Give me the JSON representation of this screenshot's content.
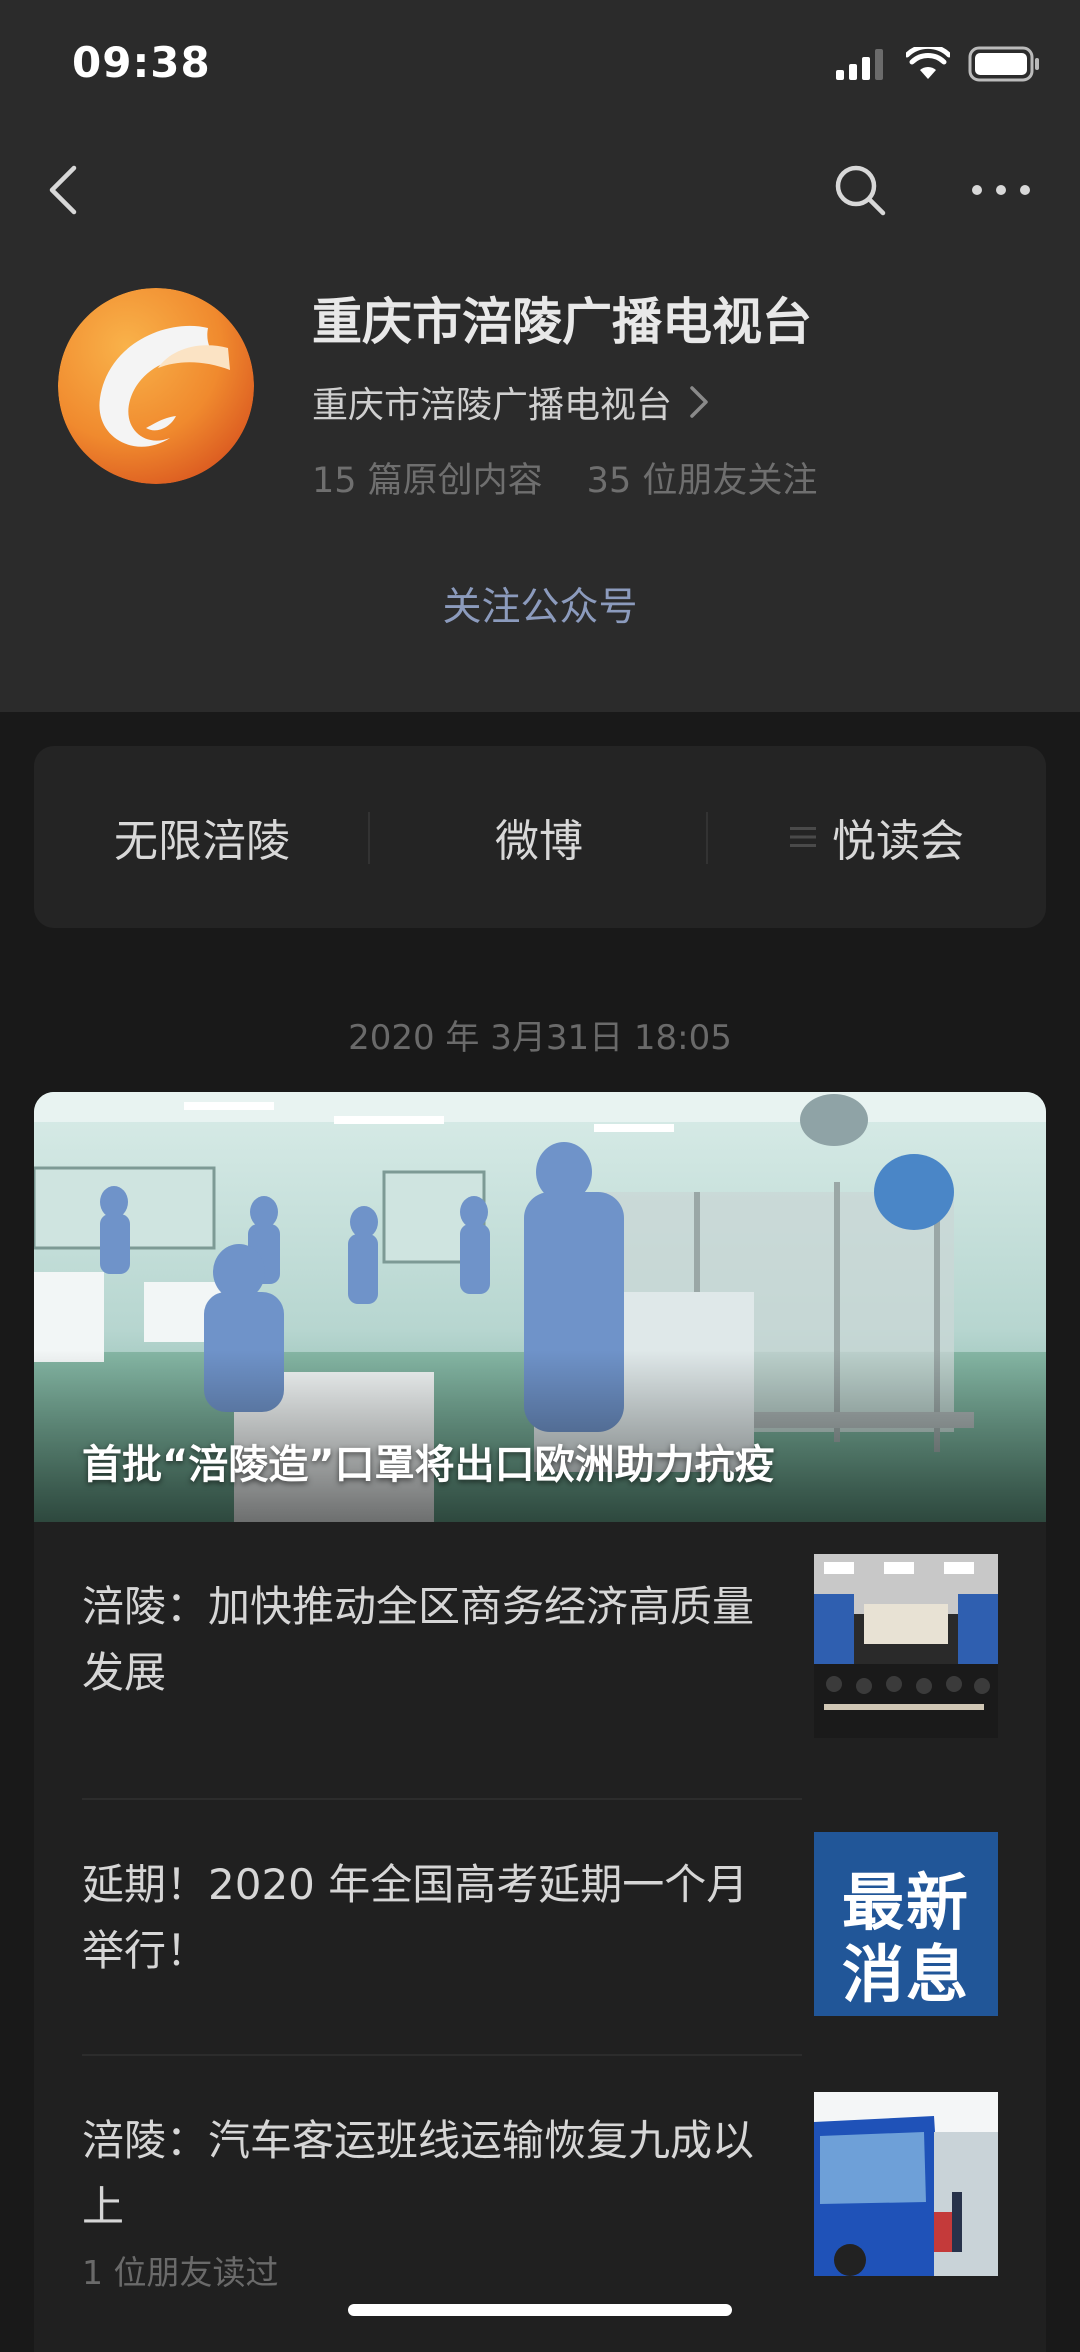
{
  "status_bar": {
    "time": "09:38"
  },
  "account": {
    "name": "重庆市涪陵广播电视台",
    "subject": "重庆市涪陵广播电视台",
    "original_count": "15 篇原创内容",
    "friends_following": "35 位朋友关注",
    "follow_label": "关注公众号"
  },
  "menu": {
    "items": [
      {
        "label": "无限涪陵"
      },
      {
        "label": "微博"
      },
      {
        "label": "悦读会"
      }
    ]
  },
  "feed": {
    "date": "2020 年 3月31日 18:05",
    "hero_title": "首批“涪陵造”口罩将出口欧洲助力抗疫",
    "articles": [
      {
        "title": "涪陵：加快推动全区商务经济高质量发展"
      },
      {
        "title": "延期！2020 年全国高考延期一个月举行！",
        "thumb_text_line1": "最新",
        "thumb_text_line2": "消息"
      },
      {
        "title": "涪陵：汽车客运班线运输恢复九成以上",
        "meta": "1 位朋友读过"
      }
    ]
  },
  "colors": {
    "background": "#191919",
    "header_background": "#2b2b2b",
    "link_accent": "#8c9bbd",
    "logo_orange": "#f08a2e"
  }
}
